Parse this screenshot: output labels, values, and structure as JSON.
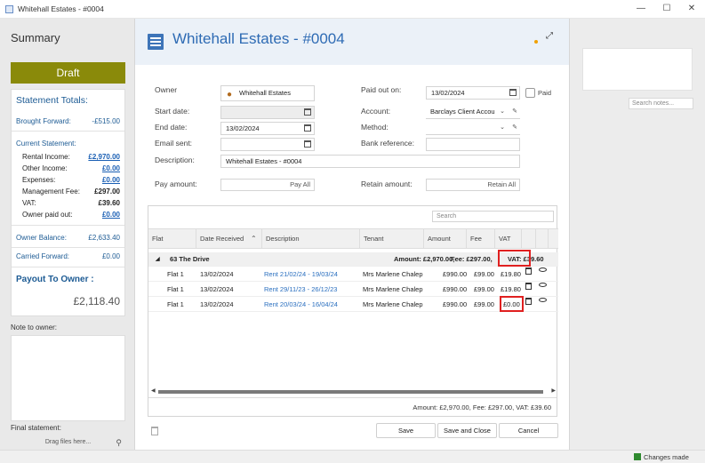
{
  "window": {
    "title": "Whitehall Estates - #0004",
    "minimize": "—",
    "maximize": "☐",
    "close": "✕"
  },
  "left": {
    "summary_title": "Summary",
    "status_button": "Draft",
    "totals": {
      "heading": "Statement Totals:",
      "brought_forward": {
        "label": "Brought Forward:",
        "value": "-£515.00"
      },
      "current_statement": {
        "label": "Current Statement:"
      },
      "rental_income": {
        "label": "Rental Income:",
        "value": "£2,970.00"
      },
      "other_income": {
        "label": "Other Income:",
        "value": "£0.00"
      },
      "expenses": {
        "label": "Expenses:",
        "value": "£0.00"
      },
      "management_fee": {
        "label": "Management Fee:",
        "value": "£297.00"
      },
      "vat": {
        "label": "VAT:",
        "value": "£39.60"
      },
      "owner_paid_out": {
        "label": "Owner paid out:",
        "value": "£0.00"
      },
      "owner_balance": {
        "label": "Owner Balance:",
        "value": "£2,633.40"
      },
      "carried_forward": {
        "label": "Carried Forward:",
        "value": "£0.00"
      },
      "payout_label": "Payout To Owner :",
      "payout_value": "£2,118.40"
    },
    "note_label": "Note to owner:",
    "final_label": "Final statement:",
    "dropzone": "Drag files here..."
  },
  "header": {
    "title": "Whitehall Estates - #0004"
  },
  "right": {
    "search_placeholder": "Search notes..."
  },
  "form": {
    "owner": {
      "label": "Owner",
      "value": "Whitehall Estates"
    },
    "start_date": {
      "label": "Start date:",
      "value": ""
    },
    "end_date": {
      "label": "End date:",
      "value": "13/02/2024"
    },
    "email_sent": {
      "label": "Email sent:",
      "value": ""
    },
    "description": {
      "label": "Description:",
      "value": "Whitehall Estates - #0004"
    },
    "pay_amount": {
      "label": "Pay amount:",
      "button": "Pay All"
    },
    "paid_out_on": {
      "label": "Paid out on:",
      "value": "13/02/2024"
    },
    "paid": {
      "label": "Paid"
    },
    "account": {
      "label": "Account:",
      "value": "Barclays Client Accou"
    },
    "method": {
      "label": "Method:",
      "value": ""
    },
    "bank_reference": {
      "label": "Bank reference:",
      "value": ""
    },
    "retain_amount": {
      "label": "Retain amount:",
      "button": "Retain All"
    }
  },
  "grid": {
    "search_placeholder": "Search",
    "columns": [
      "Flat",
      "Date Received",
      "Description",
      "Tenant",
      "Amount",
      "Fee",
      "VAT"
    ],
    "group": {
      "name": "63 The Drive",
      "amount": "Amount: £2,970.00,",
      "fee": "Fee: £297.00,",
      "vat": "VAT: £39.60"
    },
    "rows": [
      {
        "flat": "Flat 1",
        "date": "13/02/2024",
        "description": "Rent 21/02/24 - 19/03/24",
        "tenant": "Mrs Marlene Chalep",
        "amount": "£990.00",
        "fee": "£99.00",
        "vat": "£19.80"
      },
      {
        "flat": "Flat 1",
        "date": "13/02/2024",
        "description": "Rent 29/11/23 - 26/12/23",
        "tenant": "Mrs Marlene Chalep",
        "amount": "£990.00",
        "fee": "£99.00",
        "vat": "£19.80"
      },
      {
        "flat": "Flat 1",
        "date": "13/02/2024",
        "description": "Rent 20/03/24 - 16/04/24",
        "tenant": "Mrs Marlene Chalep",
        "amount": "£990.00",
        "fee": "£99.00",
        "vat": "£0.00"
      }
    ],
    "footer": "Amount: £2,970.00, Fee: £297.00, VAT: £39.60"
  },
  "buttons": {
    "save": "Save",
    "save_close": "Save and Close",
    "cancel": "Cancel"
  },
  "status": {
    "text": "Changes made"
  }
}
